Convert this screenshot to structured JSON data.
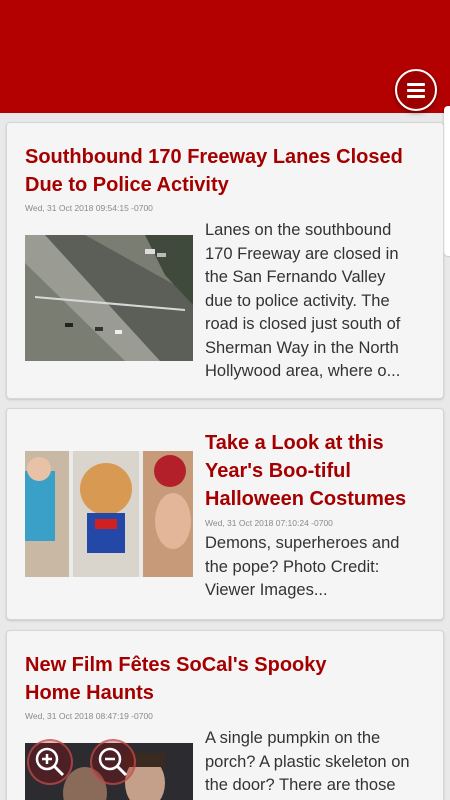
{
  "articles": [
    {
      "title_line1": "Southbound 170 Freeway Lanes Closed",
      "title_line2": "Due to Police Activity",
      "date": "Wed, 31 Oct 2018 09:54:15 -0700",
      "body_lines": [
        "Lanes on the southbound",
        "170 Freeway are closed in",
        "the San Fernando Valley",
        "due to police activity.  The",
        "road is closed just south of",
        "Sherman Way in the North",
        "Hollywood area, where o..."
      ]
    },
    {
      "title_line1": "Take a Look at this",
      "title_line2": "Year's Boo-tiful",
      "title_line3": "Halloween Costumes",
      "date": "Wed, 31 Oct 2018 07:10:24 -0700",
      "body_lines": [
        "Demons, superheroes and",
        "the pope?   Photo Credit:",
        "Viewer Images..."
      ]
    },
    {
      "title_line1": "New Film Fêtes SoCal's Spooky",
      "title_line2": "Home Haunts",
      "date": "Wed, 31 Oct 2018 08:47:19 -0700",
      "body_lines": [
        "A single pumpkin on the",
        "porch? A plastic skeleton on",
        "the door?  There are those"
      ]
    }
  ],
  "icons": {
    "menu": "menu-icon",
    "zoom_in": "zoom-in-icon",
    "zoom_out": "zoom-out-icon"
  },
  "colors": {
    "header": "#b30000",
    "title": "#a50000"
  }
}
